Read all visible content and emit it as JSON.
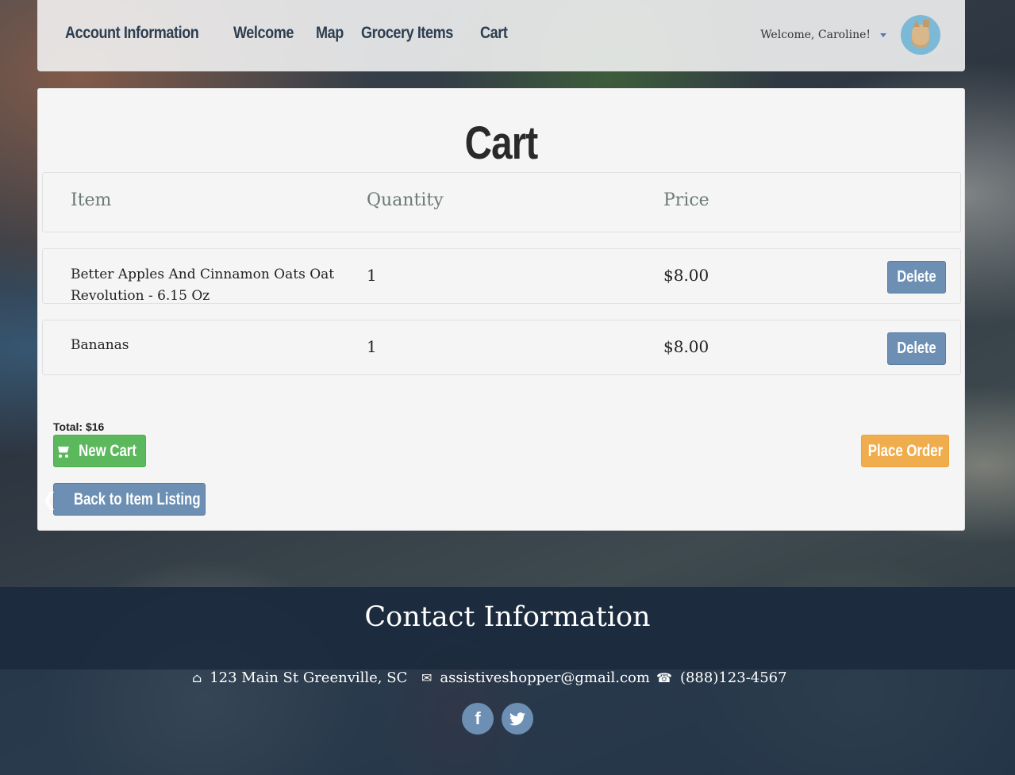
{
  "nav": {
    "links": [
      "Account Information",
      "Welcome",
      "Map",
      "Grocery Items",
      "Cart"
    ],
    "welcome": "Welcome, Caroline!"
  },
  "cart": {
    "title": "Cart",
    "headers": {
      "item": "Item",
      "quantity": "Quantity",
      "price": "Price"
    },
    "items": [
      {
        "name": "Better Apples And Cinnamon Oats Oat Revolution - 6.15 Oz",
        "quantity": "1",
        "price": "$8.00",
        "delete_label": "Delete"
      },
      {
        "name": "Bananas",
        "quantity": "1",
        "price": "$8.00",
        "delete_label": "Delete"
      }
    ],
    "total": "Total: $16",
    "new_cart_label": "New Cart",
    "place_order_label": "Place Order",
    "back_label": "Back to Item Listing"
  },
  "footer": {
    "title": "Contact Information",
    "address": "123 Main St Greenville, SC",
    "email": "assistiveshopper@gmail.com",
    "phone": "(888)123-4567"
  },
  "colors": {
    "nav_text": "#2c3e50",
    "primary": "#6c8fb3",
    "success": "#5cb85c",
    "warning": "#f0ad4e",
    "footer_bg": "#1b2b3d"
  },
  "icons": [
    "home-icon",
    "envelope-icon",
    "phone-icon",
    "shopping-cart-icon",
    "chevron-left-icon",
    "facebook-icon",
    "twitter-icon",
    "chevron-down-icon"
  ]
}
